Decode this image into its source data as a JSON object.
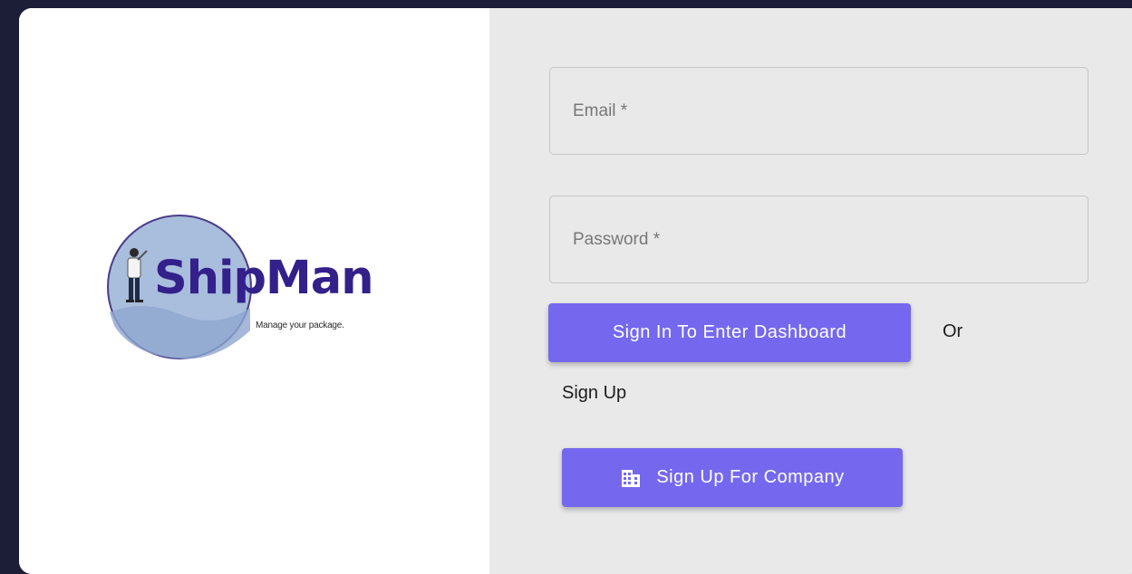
{
  "brand": {
    "name": "ShipMan",
    "tagline": "Manage your package.",
    "accent_color": "#7568ef",
    "logo_text_color": "#33208a"
  },
  "form": {
    "email_label": "Email *",
    "password_label": "Password *",
    "signin_button": "Sign In To Enter Dashboard",
    "or_text": "Or",
    "signup_heading": "Sign Up",
    "signup_company_button": "Sign Up For Company",
    "signup_company_icon": "building-icon"
  }
}
